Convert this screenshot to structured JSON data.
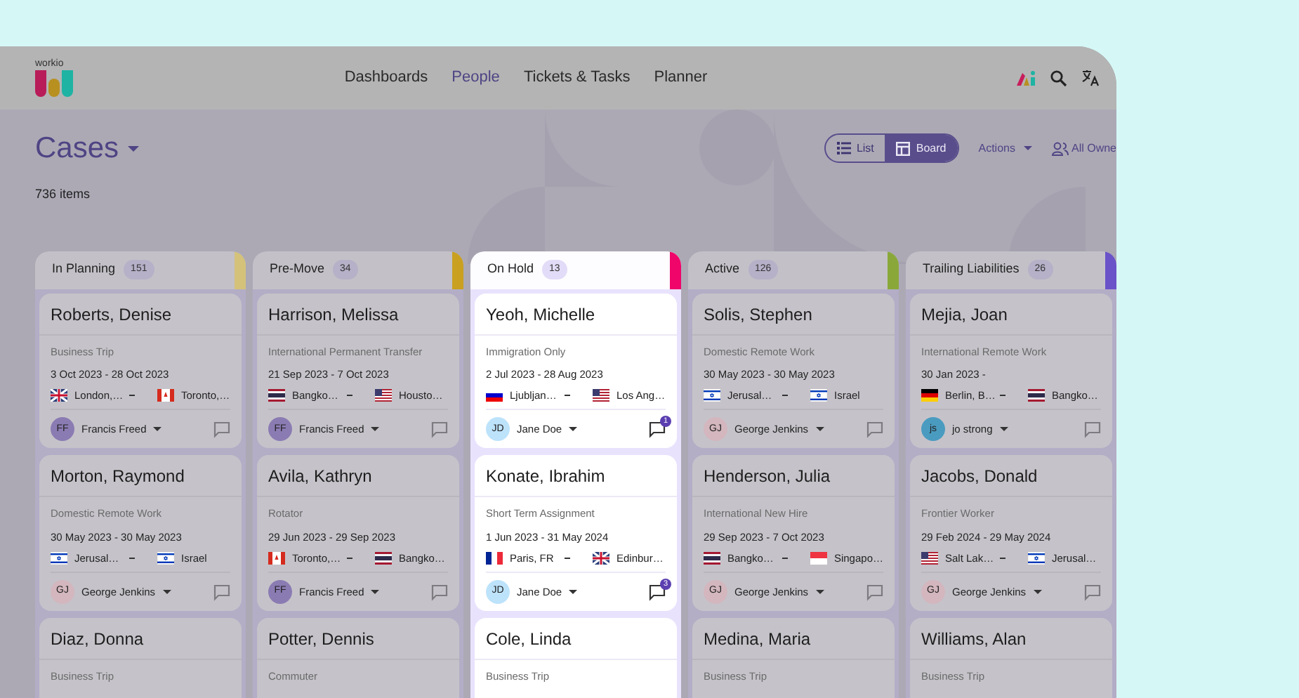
{
  "app": {
    "logo_text": "workio"
  },
  "nav": [
    {
      "label": "Dashboards",
      "selected": false
    },
    {
      "label": "People",
      "selected": true
    },
    {
      "label": "Tickets & Tasks",
      "selected": false
    },
    {
      "label": "Planner",
      "selected": false
    }
  ],
  "page": {
    "title": "Cases",
    "item_count": "736 items"
  },
  "view_toggle": [
    {
      "label": "List",
      "selected": false
    },
    {
      "label": "Board",
      "selected": true
    }
  ],
  "actions": {
    "label": "Actions"
  },
  "owner_filter": {
    "label": "All Owne"
  },
  "columns": [
    {
      "label": "In Planning",
      "count": "151",
      "color": "#d4c27a",
      "selected": false,
      "cards": [
        {
          "name": "Roberts, Denise",
          "type": "Business Trip",
          "dates": "3 Oct 2023 - 28 Oct 2023",
          "from": {
            "kind": "gb",
            "city": "London,…"
          },
          "to": {
            "kind": "ca",
            "city": "Toronto,…"
          },
          "assignee": {
            "initials": "FF",
            "name": "Francis Freed",
            "color": "#8b7bb3"
          }
        },
        {
          "name": "Morton, Raymond",
          "type": "Domestic Remote Work",
          "dates": "30 May 2023 - 30 May 2023",
          "from": {
            "kind": "il",
            "city": "Jerusal…"
          },
          "to": {
            "kind": "il",
            "city": "Israel"
          },
          "assignee": {
            "initials": "GJ",
            "name": "George Jenkins",
            "color": "#d3b6be"
          }
        },
        {
          "name": "Diaz, Donna",
          "type": "Business Trip"
        }
      ]
    },
    {
      "label": "Pre-Move",
      "count": "34",
      "color": "#c9a020",
      "selected": false,
      "cards": [
        {
          "name": "Harrison, Melissa",
          "type": "International Permanent Transfer",
          "dates": "21 Sep 2023 - 7 Oct 2023",
          "from": {
            "kind": "th",
            "city": "Bangko…"
          },
          "to": {
            "kind": "us",
            "city": "Housto…"
          },
          "assignee": {
            "initials": "FF",
            "name": "Francis Freed",
            "color": "#8b7bb3"
          }
        },
        {
          "name": "Avila, Kathryn",
          "type": "Rotator",
          "dates": "29 Jun 2023 - 29 Sep 2023",
          "from": {
            "kind": "ca",
            "city": "Toronto,…"
          },
          "to": {
            "kind": "th",
            "city": "Bangko…"
          },
          "assignee": {
            "initials": "FF",
            "name": "Francis Freed",
            "color": "#8b7bb3"
          }
        },
        {
          "name": "Potter, Dennis",
          "type": "Commuter"
        }
      ]
    },
    {
      "label": "On Hold",
      "count": "13",
      "color": "#f0056a",
      "selected": true,
      "cards": [
        {
          "name": "Yeoh, Michelle",
          "type": "Immigration Only",
          "dates": "2 Jul 2023 - 28 Aug 2023",
          "from": {
            "kind": "si",
            "city": "Ljubljan…"
          },
          "to": {
            "kind": "us",
            "city": "Los Ang…"
          },
          "assignee": {
            "initials": "JD",
            "name": "Jane Doe",
            "color": "#bde3fb"
          },
          "comments": "1"
        },
        {
          "name": "Konate, Ibrahim",
          "type": "Short Term Assignment",
          "dates": "1 Jun 2023 - 31 May 2024",
          "from": {
            "kind": "fr",
            "city": "Paris, FR"
          },
          "to": {
            "kind": "gb",
            "city": "Edinbur…"
          },
          "assignee": {
            "initials": "JD",
            "name": "Jane Doe",
            "color": "#bde3fb"
          },
          "comments": "3"
        },
        {
          "name": "Cole, Linda",
          "type": "Business Trip"
        }
      ]
    },
    {
      "label": "Active",
      "count": "126",
      "color": "#8aa83a",
      "selected": false,
      "cards": [
        {
          "name": "Solis, Stephen",
          "type": "Domestic Remote Work",
          "dates": "30 May 2023 - 30 May 2023",
          "from": {
            "kind": "il",
            "city": "Jerusal…"
          },
          "to": {
            "kind": "il",
            "city": "Israel"
          },
          "assignee": {
            "initials": "GJ",
            "name": "George Jenkins",
            "color": "#d3b6be"
          }
        },
        {
          "name": "Henderson, Julia",
          "type": "International New Hire",
          "dates": "29 Sep 2023 - 7 Oct 2023",
          "from": {
            "kind": "th",
            "city": "Bangko…"
          },
          "to": {
            "kind": "sg",
            "city": "Singapo…"
          },
          "assignee": {
            "initials": "GJ",
            "name": "George Jenkins",
            "color": "#d3b6be"
          }
        },
        {
          "name": "Medina, Maria",
          "type": "Business Trip"
        }
      ]
    },
    {
      "label": "Trailing Liabilities",
      "count": "26",
      "color": "#6a52c8",
      "selected": false,
      "cards": [
        {
          "name": "Mejia, Joan",
          "type": "International Remote Work",
          "dates": "30 Jan 2023 -",
          "from": {
            "kind": "de",
            "city": "Berlin, B…"
          },
          "to": {
            "kind": "th",
            "city": "Bangko…"
          },
          "assignee": {
            "initials": "js",
            "name": "jo strong",
            "color": "#4a9bc0"
          }
        },
        {
          "name": "Jacobs, Donald",
          "type": "Frontier Worker",
          "dates": "29 Feb 2024 - 29 May 2024",
          "from": {
            "kind": "us",
            "city": "Salt Lak…"
          },
          "to": {
            "kind": "il",
            "city": "Jerusal…"
          },
          "assignee": {
            "initials": "GJ",
            "name": "George Jenkins",
            "color": "#d3b6be"
          }
        },
        {
          "name": "Williams, Alan",
          "type": "Business Trip"
        }
      ]
    }
  ]
}
